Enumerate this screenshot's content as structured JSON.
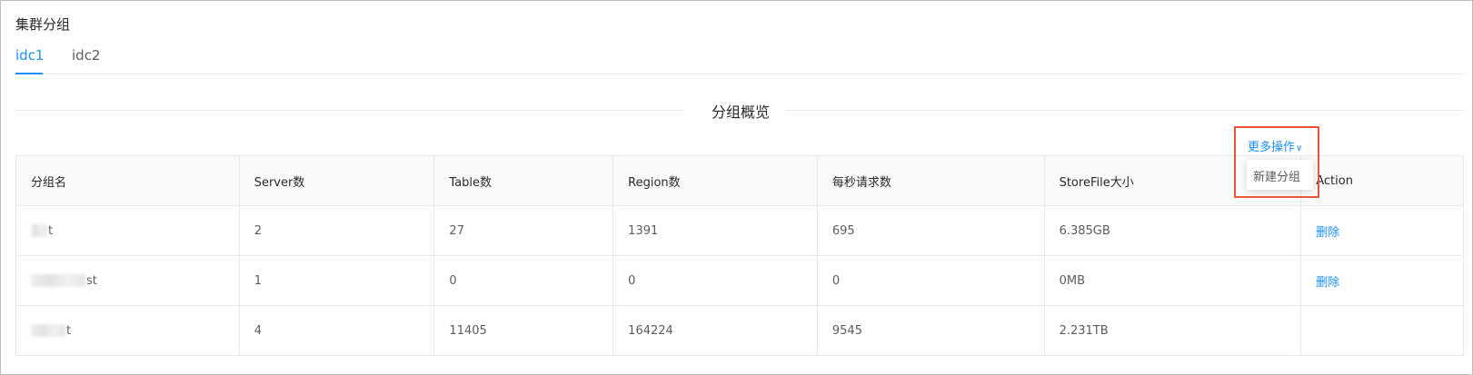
{
  "page": {
    "title": "集群分组"
  },
  "tabs": [
    {
      "label": "idc1",
      "active": true
    },
    {
      "label": "idc2",
      "active": false
    }
  ],
  "section": {
    "divider_title": "分组概览"
  },
  "toolbar": {
    "more_actions_label": "更多操作",
    "more_actions_icon": "chevron-down-icon"
  },
  "dropdown": {
    "items": [
      {
        "label": "新建分组"
      }
    ]
  },
  "table": {
    "columns": [
      "分组名",
      "Server数",
      "Table数",
      "Region数",
      "每秒请求数",
      "StoreFile大小",
      "Action"
    ],
    "rows": [
      {
        "name_suffix": "t",
        "servers": "2",
        "tables": "27",
        "regions": "1391",
        "requests": "695",
        "storefile": "6.385GB",
        "action": "删除"
      },
      {
        "name_suffix": "st",
        "servers": "1",
        "tables": "0",
        "regions": "0",
        "requests": "0",
        "storefile": "0MB",
        "action": "删除"
      },
      {
        "name_suffix": "t",
        "servers": "4",
        "tables": "11405",
        "regions": "164224",
        "requests": "9545",
        "storefile": "2.231TB",
        "action": ""
      }
    ]
  },
  "colors": {
    "accent": "#1890ff",
    "highlight_border": "#e8563a",
    "border": "#e8e8e8",
    "header_bg": "#fafafa"
  }
}
